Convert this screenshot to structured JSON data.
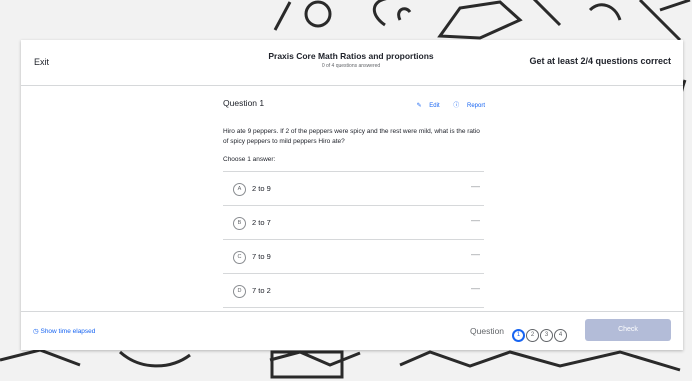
{
  "header": {
    "exit_label": "Exit",
    "title": "Praxis Core Math Ratios and proportions",
    "subtitle": "0 of 4 questions answered",
    "goal": "Get at least 2/4 questions correct"
  },
  "question": {
    "title": "Question 1",
    "edit_label": "Edit",
    "report_label": "Report",
    "text": "Hiro ate 9 peppers. If 2 of the peppers were spicy and the rest were mild, what is the ratio of spicy peppers to mild peppers Hiro ate?",
    "prompt": "Choose 1 answer:"
  },
  "choices": [
    {
      "letter": "A",
      "text": "2 to 9"
    },
    {
      "letter": "B",
      "text": "2 to 7"
    },
    {
      "letter": "C",
      "text": "7 to 9"
    },
    {
      "letter": "D",
      "text": "7 to 2"
    }
  ],
  "footer": {
    "show_time": "Show time elapsed",
    "question_label": "Question",
    "dots": [
      "1",
      "2",
      "3",
      "4"
    ],
    "check_label": "Check"
  },
  "colors": {
    "accent": "#1865f2",
    "check_disabled": "#b3bcd8"
  }
}
